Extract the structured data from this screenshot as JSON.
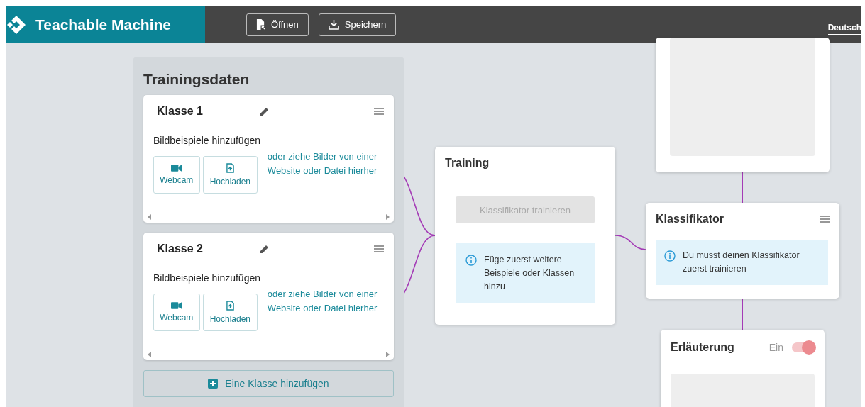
{
  "header": {
    "logo_text": "Teachable Machine",
    "buttons": [
      {
        "label": "Öffnen",
        "kind": "open"
      },
      {
        "label": "Speichern",
        "kind": "save"
      }
    ],
    "language": "Deutsch"
  },
  "training_data": {
    "title": "Trainingsdaten",
    "classes": [
      {
        "name": "Klasse 1",
        "subtitle": "Bildbeispiele hinzufügen",
        "sources": [
          {
            "label": "Webcam",
            "kind": "webcam"
          },
          {
            "label": "Hochladen",
            "kind": "upload"
          }
        ],
        "drop_hint": "oder ziehe Bilder von einer Website oder Datei hierher"
      },
      {
        "name": "Klasse 2",
        "subtitle": "Bildbeispiele hinzufügen",
        "sources": [
          {
            "label": "Webcam",
            "kind": "webcam"
          },
          {
            "label": "Hochladen",
            "kind": "upload"
          }
        ],
        "drop_hint": "oder ziehe Bilder von einer Website oder Datei hierher"
      }
    ],
    "add_button": "Eine Klasse hinzufügen"
  },
  "training": {
    "title": "Training",
    "button": {
      "label": "Klassifikator trainieren",
      "disabled": true
    },
    "info": "Füge zuerst weitere Beispiele oder Klassen hinzu"
  },
  "classifier": {
    "title": "Klassifikator",
    "info": "Du musst deinen Klassifikator zuerst trainieren"
  },
  "explanation": {
    "title": "Erläuterung",
    "toggle_label": "Ein",
    "on": true
  }
}
